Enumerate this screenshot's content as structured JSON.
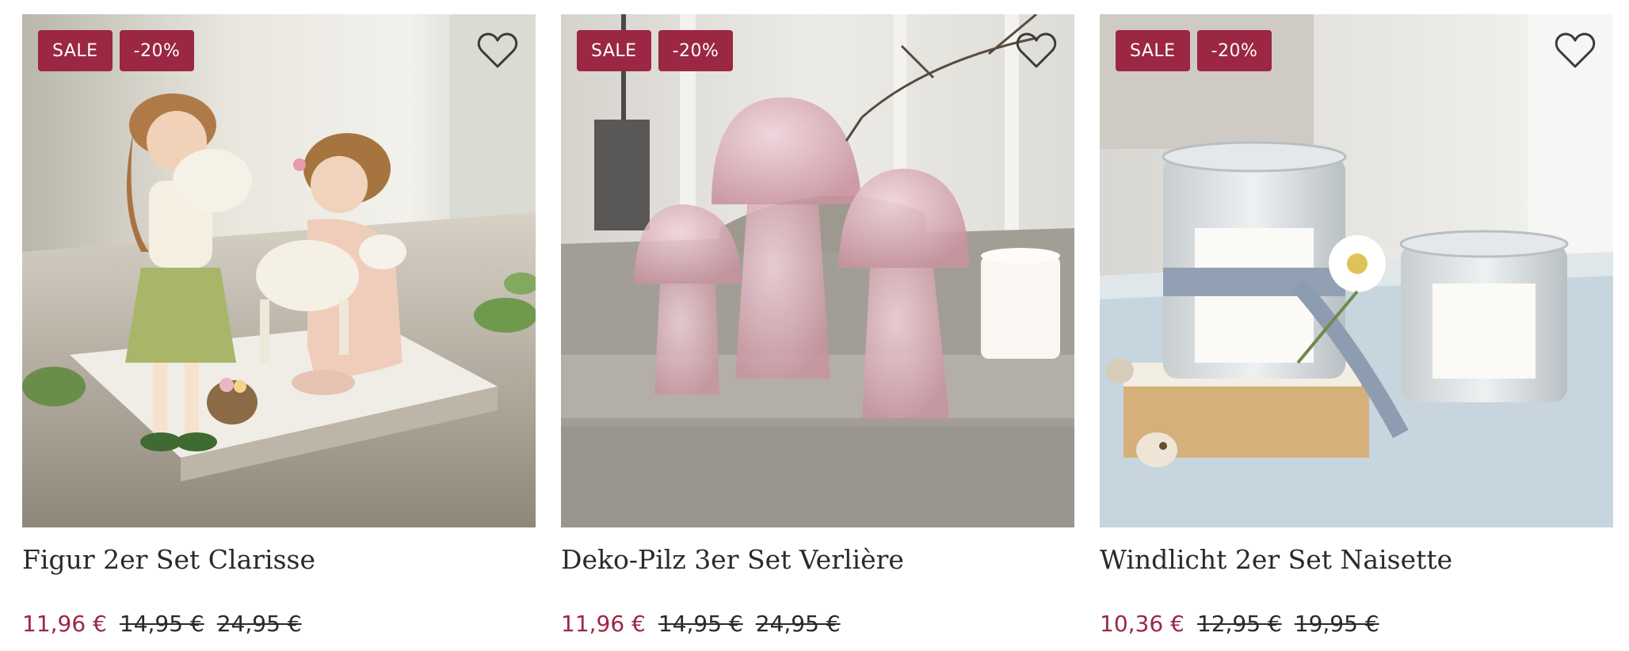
{
  "products": [
    {
      "badges": [
        "SALE",
        "-20%"
      ],
      "title": "Figur 2er Set Clarisse",
      "price": "11,96 €",
      "old_prices": [
        "14,95 €",
        "24,95 €"
      ]
    },
    {
      "badges": [
        "SALE",
        "-20%"
      ],
      "title": "Deko-Pilz 3er Set Verlière",
      "price": "11,96 €",
      "old_prices": [
        "14,95 €",
        "24,95 €"
      ]
    },
    {
      "badges": [
        "SALE",
        "-20%"
      ],
      "title": "Windlicht 2er Set Naisette",
      "price": "10,36 €",
      "old_prices": [
        "12,95 €",
        "19,95 €"
      ]
    }
  ],
  "icons": {
    "wishlist": "heart-outline-icon"
  },
  "colors": {
    "accent": "#9b2742",
    "text": "#2a2a2a"
  }
}
